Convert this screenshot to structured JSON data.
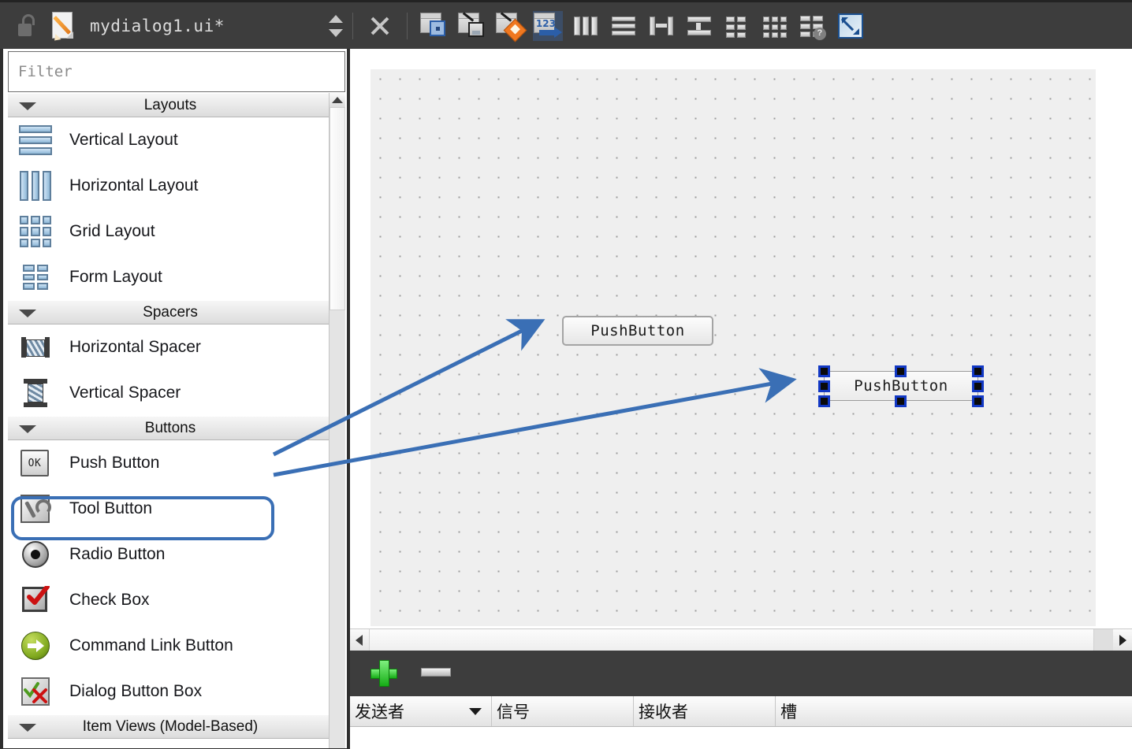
{
  "app": {
    "titlebar": {
      "lock_icon": "unlock-icon",
      "file_icon": "file-edit-icon",
      "filename": "mydialog1.ui*",
      "spinner_icon": "spin-up-down-icon"
    },
    "toolbar": {
      "items": [
        {
          "name": "close-form-button",
          "icon": "close-x-icon",
          "tooltip": "Close"
        },
        {
          "name": "edit-widgets-button",
          "icon": "edit-widgets-icon",
          "tooltip": "Edit Widgets"
        },
        {
          "name": "edit-signals-slots-button",
          "icon": "edit-signals-slots-icon",
          "tooltip": "Edit Signals/Slots"
        },
        {
          "name": "edit-buddies-button",
          "icon": "edit-buddies-icon",
          "tooltip": "Edit Buddies"
        },
        {
          "name": "edit-tab-order-button",
          "icon": "edit-tab-order-icon",
          "label": "123",
          "tooltip": "Edit Tab Order"
        },
        {
          "name": "lay-out-horizontally-button",
          "icon": "layout-horizontal-icon",
          "tooltip": "Lay Out Horizontally"
        },
        {
          "name": "lay-out-vertically-button",
          "icon": "layout-vertical-icon",
          "tooltip": "Lay Out Vertically"
        },
        {
          "name": "lay-out-in-splitter-horizontal-button",
          "icon": "splitter-horizontal-icon",
          "tooltip": "Lay Out Horizontally in Splitter"
        },
        {
          "name": "lay-out-in-splitter-vertical-button",
          "icon": "splitter-vertical-icon",
          "tooltip": "Lay Out Vertically in Splitter"
        },
        {
          "name": "lay-out-in-form-layout-button",
          "icon": "form-layout-icon",
          "tooltip": "Lay Out in a Form Layout"
        },
        {
          "name": "lay-out-in-grid-button",
          "icon": "grid-layout-icon",
          "tooltip": "Lay Out in a Grid"
        },
        {
          "name": "break-layout-button",
          "icon": "break-layout-icon",
          "tooltip": "Break Layout"
        },
        {
          "name": "adjust-size-button",
          "icon": "adjust-size-icon",
          "tooltip": "Adjust Size"
        }
      ]
    }
  },
  "sidebar": {
    "filter": {
      "placeholder": "Filter",
      "value": ""
    },
    "categories": [
      {
        "title": "Layouts",
        "expanded": true,
        "items": [
          {
            "label": "Vertical Layout",
            "icon": "vertical-layout-icon"
          },
          {
            "label": "Horizontal Layout",
            "icon": "horizontal-layout-icon"
          },
          {
            "label": "Grid Layout",
            "icon": "grid-layout-icon"
          },
          {
            "label": "Form Layout",
            "icon": "form-layout-icon"
          }
        ]
      },
      {
        "title": "Spacers",
        "expanded": true,
        "items": [
          {
            "label": "Horizontal Spacer",
            "icon": "horizontal-spacer-icon"
          },
          {
            "label": "Vertical Spacer",
            "icon": "vertical-spacer-icon"
          }
        ]
      },
      {
        "title": "Buttons",
        "expanded": true,
        "items": [
          {
            "label": "Push Button",
            "icon": "push-button-icon",
            "icon_label": "OK",
            "highlighted": true
          },
          {
            "label": "Tool Button",
            "icon": "tool-button-icon"
          },
          {
            "label": "Radio Button",
            "icon": "radio-button-icon"
          },
          {
            "label": "Check Box",
            "icon": "check-box-icon"
          },
          {
            "label": "Command Link Button",
            "icon": "command-link-button-icon"
          },
          {
            "label": "Dialog Button Box",
            "icon": "dialog-button-box-icon"
          }
        ]
      },
      {
        "title": "Item Views (Model-Based)",
        "expanded": true,
        "items": []
      }
    ],
    "scrollbar": {
      "name": "sidebar-vertical-scrollbar"
    }
  },
  "canvas": {
    "widgets": [
      {
        "name": "pushbutton-1",
        "text": "PushButton",
        "selected": false
      },
      {
        "name": "pushbutton-2",
        "text": "PushButton",
        "selected": true
      }
    ],
    "hscrollbar": {
      "name": "canvas-horizontal-scrollbar"
    }
  },
  "signal_slot_editor": {
    "toolbar": {
      "add_label": "add-connection",
      "remove_label": "remove-connection"
    },
    "columns": [
      {
        "label": "发送者",
        "sorted": true
      },
      {
        "label": "信号",
        "sorted": false
      },
      {
        "label": "接收者",
        "sorted": false
      },
      {
        "label": "槽",
        "sorted": false
      }
    ],
    "rows": []
  },
  "annotations": {
    "arrow_color": "#3a6fb5",
    "arrows": [
      {
        "name": "arrow-to-pushbutton-1",
        "from": "push-button-palette-item",
        "to": "pushbutton-1"
      },
      {
        "name": "arrow-to-pushbutton-2",
        "from": "push-button-palette-item",
        "to": "pushbutton-2"
      }
    ],
    "highlight_box": {
      "name": "push-button-highlight",
      "target": "push-button-palette-item"
    }
  },
  "colors": {
    "chrome_dark": "#3d3d3d",
    "canvas_form": "#efefef",
    "accent_blue": "#3a6fb5",
    "selection_handle": "#1238c4",
    "add_green": "#16ad16"
  }
}
